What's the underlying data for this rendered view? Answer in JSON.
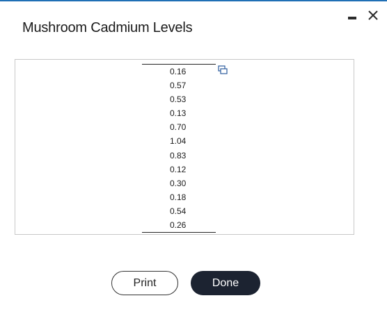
{
  "dialog": {
    "title": "Mushroom Cadmium Levels"
  },
  "window_controls": {
    "minimize_icon": "minimize-icon",
    "close_icon": "close-icon"
  },
  "data_table": {
    "values": [
      "0.16",
      "0.57",
      "0.53",
      "0.13",
      "0.70",
      "1.04",
      "0.83",
      "0.12",
      "0.30",
      "0.18",
      "0.54",
      "0.26"
    ],
    "copy_icon": "copy-icon"
  },
  "buttons": {
    "print_label": "Print",
    "done_label": "Done"
  },
  "colors": {
    "accent_line": "#1f6fb5",
    "done_button_bg": "#1c2331"
  }
}
